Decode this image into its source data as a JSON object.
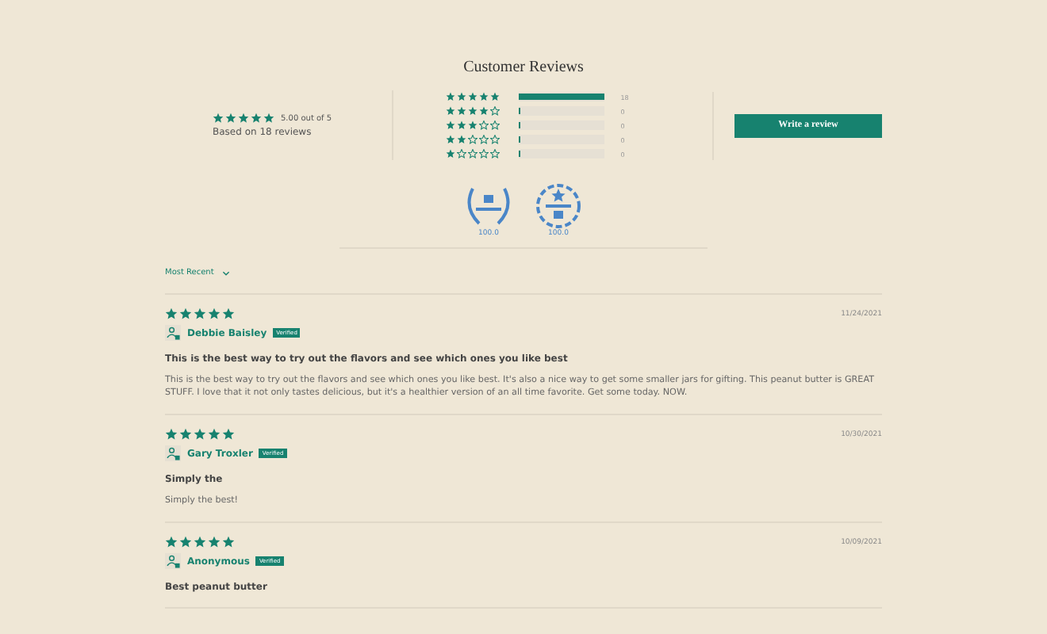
{
  "title": "Customer Reviews",
  "summary": {
    "stars": 5,
    "rating": "5.00 out of 5",
    "based_on": "Based on 18 reviews"
  },
  "histogram": [
    {
      "stars": 5,
      "level": 1,
      "count": "18"
    },
    {
      "stars": 4,
      "level": 0,
      "count": "0"
    },
    {
      "stars": 3,
      "level": 0,
      "count": "0"
    },
    {
      "stars": 2,
      "level": 0,
      "count": "0"
    },
    {
      "stars": 1,
      "level": 0,
      "count": "0"
    }
  ],
  "write_button": "Write a review",
  "badges": [
    {
      "kind": "laurel",
      "score": "100.0"
    },
    {
      "kind": "ring",
      "score": "100.0"
    }
  ],
  "sort": {
    "label": "Most Recent"
  },
  "reviews": [
    {
      "stars": 5,
      "date": "11/24/2021",
      "author": "Debbie Baisley",
      "verified": "Verified",
      "title": "This is the best way to try out the flavors and see which ones you like best",
      "body": "This is the best way to try out the flavors and see which ones you like best. It's also a nice way to get some smaller jars for gifting. This peanut butter is GREAT STUFF. I love that it not only tastes delicious, but it's a healthier version of an all time favorite. Get some today. NOW."
    },
    {
      "stars": 5,
      "date": "10/30/2021",
      "author": "Gary Troxler",
      "verified": "Verified",
      "title": "Simply the",
      "body": "Simply the best!"
    },
    {
      "stars": 5,
      "date": "10/09/2021",
      "author": "Anonymous",
      "verified": "Verified",
      "title": "Best peanut butter"
    }
  ]
}
